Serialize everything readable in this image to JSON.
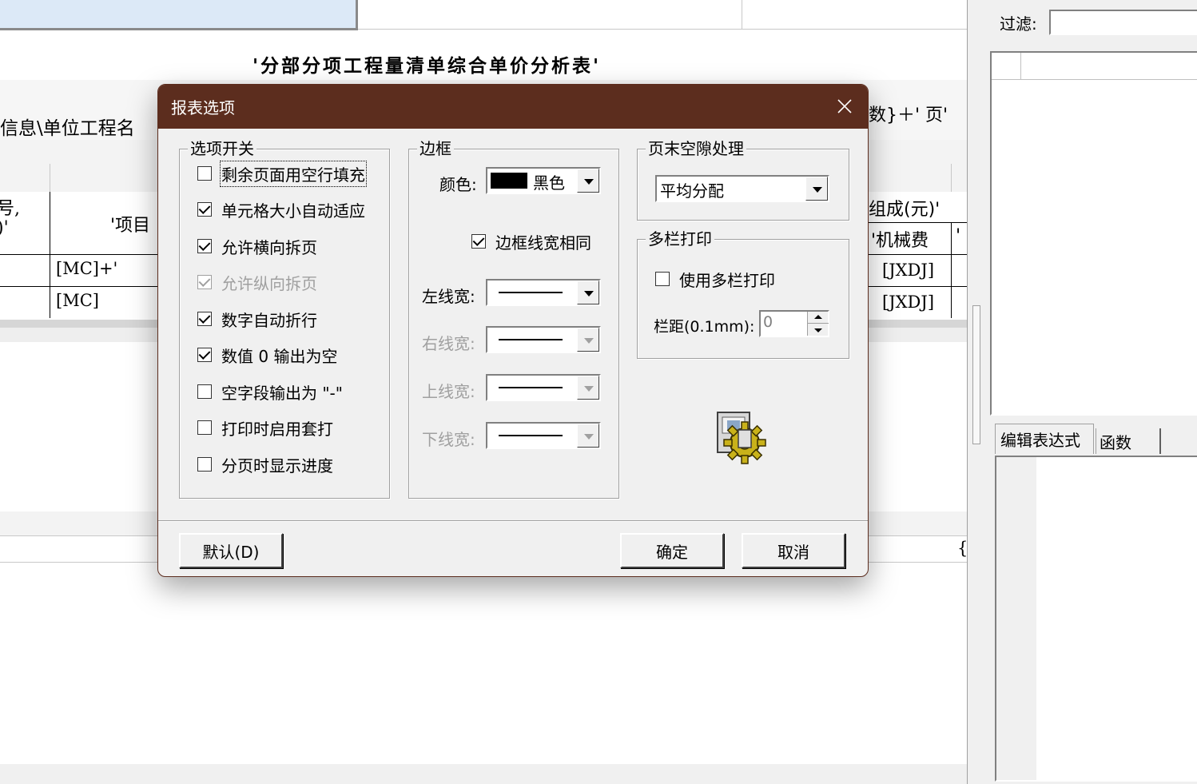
{
  "background": {
    "report_title": "'分部分项工程量清单综合单价分析表'",
    "path_text": "信息\\单位工程名",
    "page_text": "数}＋' 页'",
    "col_header_left": "号,\n)'",
    "col_header_item": "'项目",
    "col_header_compose": "组成(元)'",
    "col_header_machine": "'机械费",
    "col_header_quote": "'",
    "cell_mc1": "[MC]+'",
    "cell_mc2": "[MC]",
    "cell_jxdj1": "[JXDJ]",
    "cell_jxdj2": "[JXDJ]",
    "brace": "{"
  },
  "right_panel": {
    "filter_label": "过滤:",
    "filter_value": "",
    "tab_edit_expr": "编辑表达式",
    "tab_functions": "函数"
  },
  "dialog": {
    "title": "报表选项",
    "options_group": {
      "title": "选项开关",
      "items": [
        {
          "label": "剩余页面用空行填充",
          "checked": false,
          "disabled": false,
          "focused": true
        },
        {
          "label": "单元格大小自动适应",
          "checked": true,
          "disabled": false
        },
        {
          "label": "允许横向拆页",
          "checked": true,
          "disabled": false
        },
        {
          "label": "允许纵向拆页",
          "checked": true,
          "disabled": true
        },
        {
          "label": "数字自动折行",
          "checked": true,
          "disabled": false
        },
        {
          "label": "数值 0 输出为空",
          "checked": true,
          "disabled": false
        },
        {
          "label": "空字段输出为 \"-\"",
          "checked": false,
          "disabled": false
        },
        {
          "label": "打印时启用套打",
          "checked": false,
          "disabled": false
        },
        {
          "label": "分页时显示进度",
          "checked": false,
          "disabled": false
        }
      ]
    },
    "border_group": {
      "title": "边框",
      "color_label": "颜色:",
      "color_value": "黑色",
      "color_swatch": "#000000",
      "same_width_label": "边框线宽相同",
      "same_width_checked": true,
      "left_width_label": "左线宽:",
      "right_width_label": "右线宽:",
      "top_width_label": "上线宽:",
      "bottom_width_label": "下线宽:"
    },
    "page_end_group": {
      "title": "页末空隙处理",
      "value": "平均分配"
    },
    "multi_col_group": {
      "title": "多栏打印",
      "use_label": "使用多栏打印",
      "use_checked": false,
      "spacing_label": "栏距(0.1mm):",
      "spacing_value": "0"
    },
    "buttons": {
      "default": "默认(D)",
      "ok": "确定",
      "cancel": "取消"
    }
  }
}
